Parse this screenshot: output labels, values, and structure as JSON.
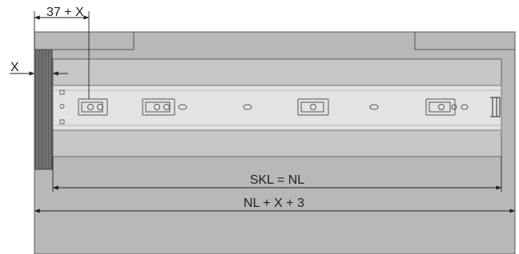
{
  "dimensions": {
    "offset_label": "37 + X",
    "x_label": "X",
    "slide_length_label": "SKL = NL",
    "total_length_label": "NL + X + 3"
  },
  "colors": {
    "cabinet_fill": "#b7b7b7",
    "cabinet_stroke": "#555555",
    "rail_fill": "#e2e2e2",
    "front_panel": "#6e6e6e",
    "dimension_line": "#222222"
  }
}
